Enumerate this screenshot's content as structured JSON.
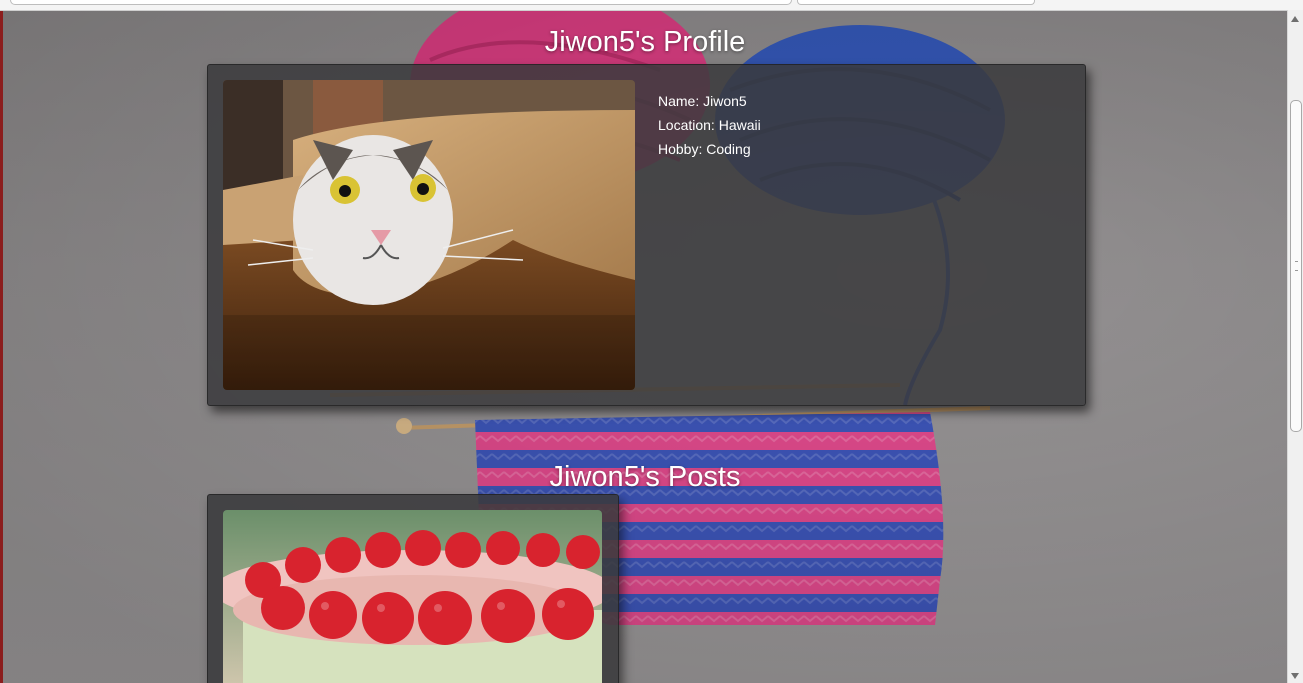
{
  "page": {
    "profile_heading": "Jiwon5's Profile",
    "posts_heading": "Jiwon5's Posts"
  },
  "profile": {
    "name_line": "Name: Jiwon5",
    "location_line": "Location: Hawaii",
    "hobby_line": "Hobby: Coding",
    "photo_icon": "cat-in-paper-photo"
  },
  "posts": [
    {
      "photo_icon": "raspberry-cake-photo"
    }
  ],
  "colors": {
    "card_bg": "#3a3a3c",
    "text": "#ffffff",
    "yarn_pink": "#e33f86",
    "yarn_blue": "#3a5fc2"
  }
}
